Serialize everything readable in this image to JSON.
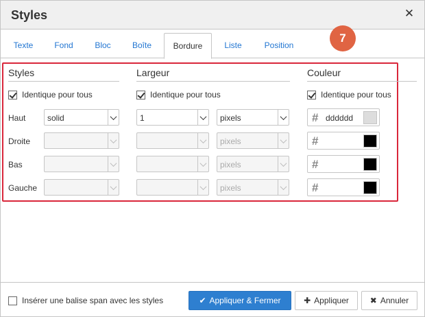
{
  "dialog": {
    "title": "Styles"
  },
  "tabs": [
    {
      "label": "Texte"
    },
    {
      "label": "Fond"
    },
    {
      "label": "Bloc"
    },
    {
      "label": "Boîte"
    },
    {
      "label": "Bordure"
    },
    {
      "label": "Liste"
    },
    {
      "label": "Position"
    }
  ],
  "active_tab": "Bordure",
  "step_badge": "7",
  "columns": {
    "styles": {
      "title": "Styles",
      "same_for_all_label": "Identique pour tous",
      "same_for_all_checked": true
    },
    "width": {
      "title": "Largeur",
      "same_for_all_label": "Identique pour tous",
      "same_for_all_checked": true
    },
    "color": {
      "title": "Couleur",
      "same_for_all_label": "Identique pour tous",
      "same_for_all_checked": true
    }
  },
  "rows": [
    {
      "label": "Haut",
      "style": "solid",
      "width": "1",
      "unit": "pixels",
      "color": "dddddd",
      "swatch": "#dddddd",
      "enabled": true
    },
    {
      "label": "Droite",
      "style": "",
      "width": "",
      "unit": "pixels",
      "color": "",
      "swatch": "#000000",
      "enabled": false
    },
    {
      "label": "Bas",
      "style": "",
      "width": "",
      "unit": "pixels",
      "color": "",
      "swatch": "#000000",
      "enabled": false
    },
    {
      "label": "Gauche",
      "style": "",
      "width": "",
      "unit": "pixels",
      "color": "",
      "swatch": "#000000",
      "enabled": false
    }
  ],
  "footer": {
    "span_checkbox_label": "Insérer une balise span avec les styles",
    "span_checkbox_checked": false,
    "apply_close_label": "Appliquer & Fermer",
    "apply_label": "Appliquer",
    "cancel_label": "Annuler"
  },
  "colors": {
    "accent": "#2e7fd0",
    "tab_link": "#2276d2",
    "highlight": "#d9263a",
    "badge": "#e06443"
  }
}
